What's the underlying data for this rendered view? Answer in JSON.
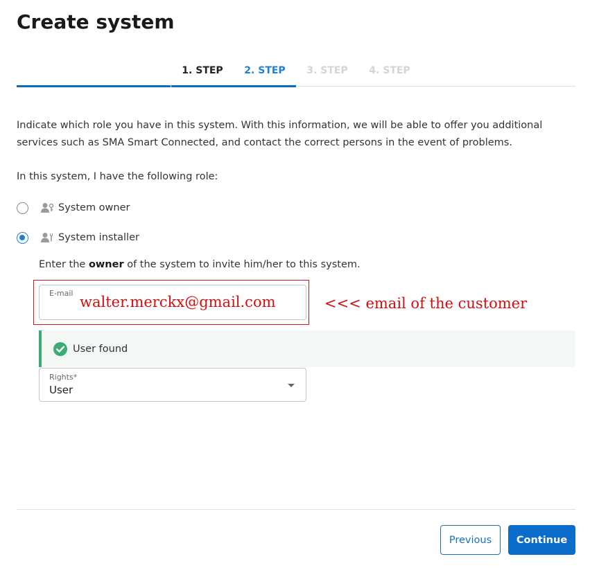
{
  "page": {
    "title": "Create system"
  },
  "stepper": {
    "steps": [
      {
        "label": "1. STEP",
        "state": "done"
      },
      {
        "label": "2. STEP",
        "state": "active"
      },
      {
        "label": "3. STEP",
        "state": "todo"
      },
      {
        "label": "4. STEP",
        "state": "todo"
      }
    ]
  },
  "intro": {
    "text": "Indicate which role you have in this system. With this information, we will be able to offer you additional services such as SMA Smart Connected, and contact the correct persons in the event of problems."
  },
  "roles": {
    "question": "In this system, I have the following role:",
    "options": [
      {
        "label": "System owner",
        "icon": "user-key-icon",
        "checked": false
      },
      {
        "label": "System installer",
        "icon": "user-wrench-icon",
        "checked": true
      }
    ]
  },
  "invite": {
    "prefix": "Enter the ",
    "bold": "owner",
    "suffix": " of the system to invite him/her to this system."
  },
  "email_field": {
    "label": "E-mail",
    "value": "walter.merckx@gmail.com"
  },
  "annotation": {
    "text": "<<< email of the customer"
  },
  "alert": {
    "text": "User found",
    "icon": "check-circle-icon"
  },
  "rights_field": {
    "label": "Rights*",
    "value": "User"
  },
  "footer": {
    "previous_label": "Previous",
    "continue_label": "Continue"
  },
  "colors": {
    "primary": "#0c6cc9",
    "success": "#3dab78",
    "annotation": "#d10f0f"
  }
}
